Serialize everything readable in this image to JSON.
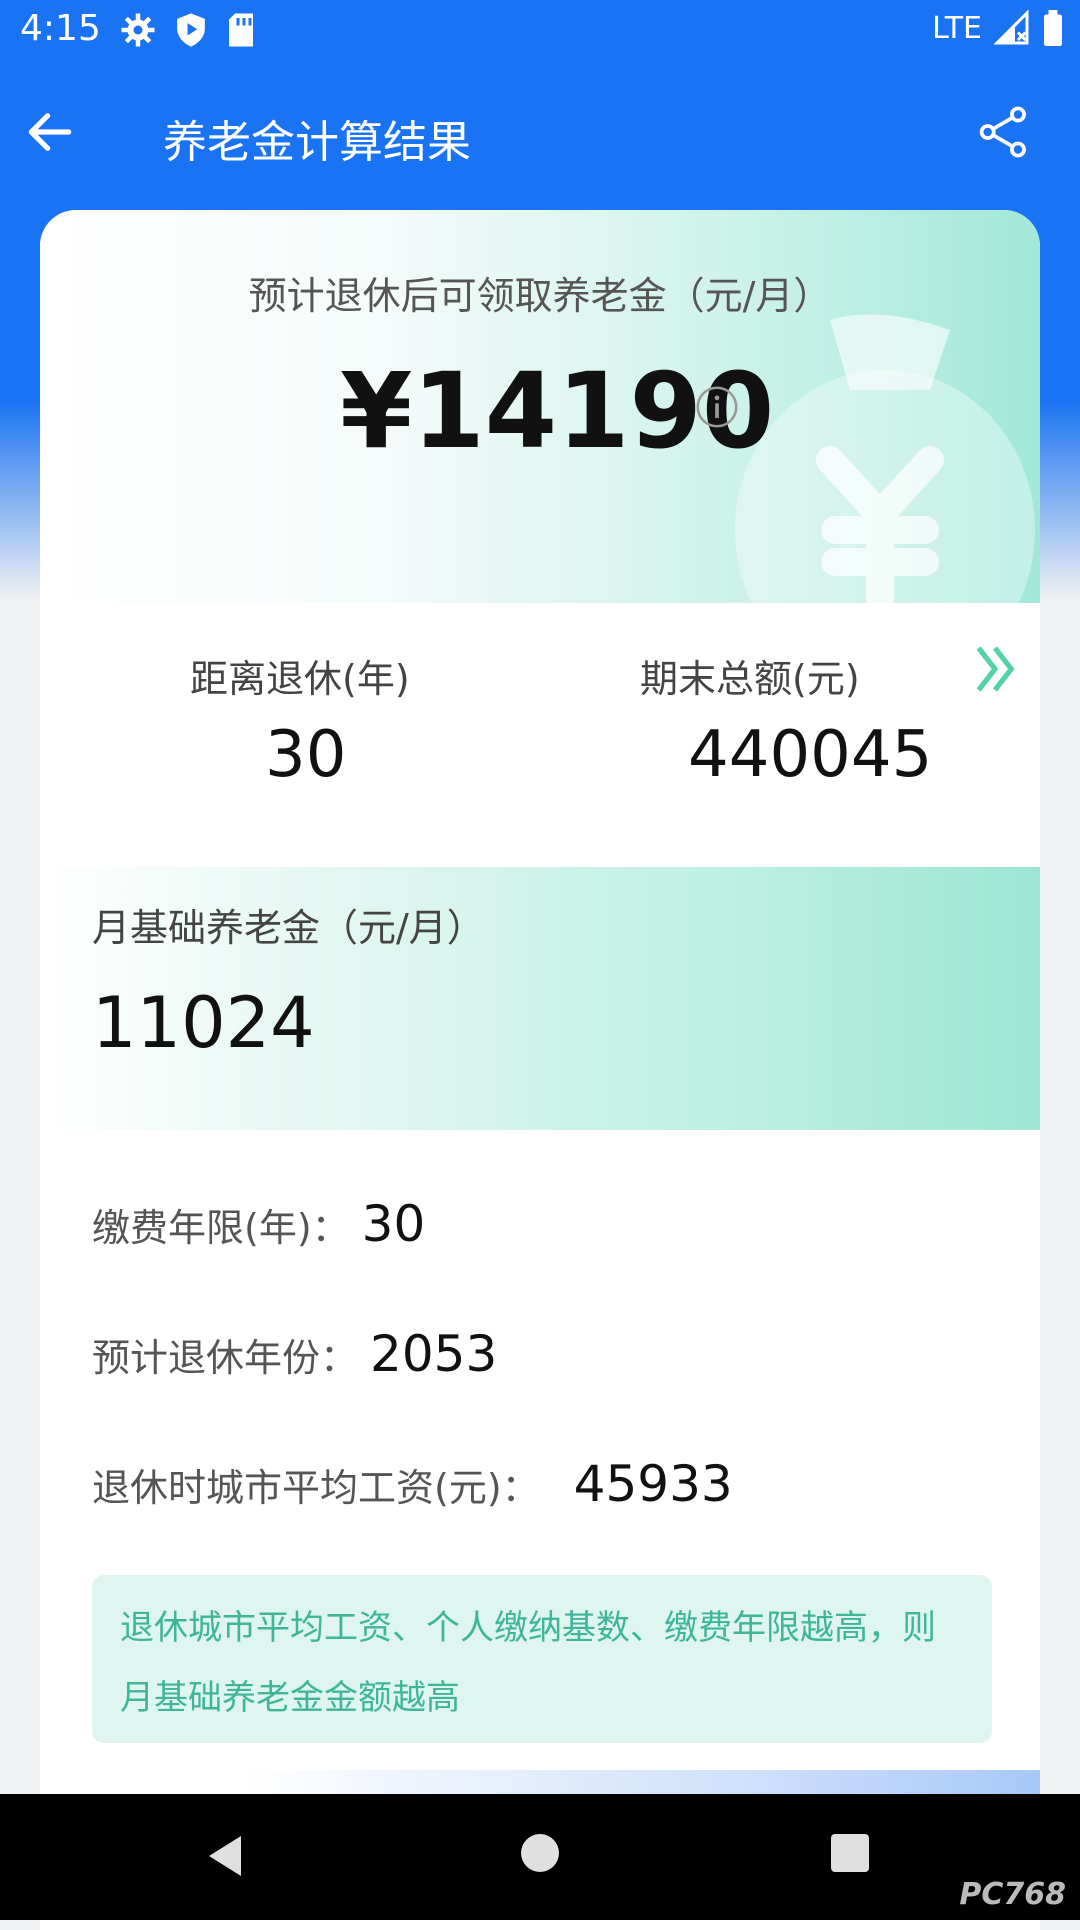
{
  "status_bar": {
    "time": "4:15",
    "network": "LTE",
    "icons": [
      "gear-icon",
      "shield-play-icon",
      "sd-card-icon",
      "signal-icon",
      "battery-icon"
    ]
  },
  "app_bar": {
    "title": "养老金计算结果",
    "back_icon": "arrow-left-icon",
    "share_icon": "share-icon"
  },
  "hero": {
    "label": "预计退休后可领取养老金（元/月）",
    "amount": "¥14190",
    "info_icon": "info-icon"
  },
  "stats": {
    "years_label": "距离退休(年)",
    "years_value": "30",
    "total_label": "期末总额(元)",
    "total_value": "440045",
    "more_icon": "double-chevron-right-icon"
  },
  "monthly": {
    "label": "月基础养老金（元/月）",
    "value": "11024"
  },
  "details": [
    {
      "label": "缴费年限(年)：",
      "value": "30"
    },
    {
      "label": "预计退休年份：",
      "value": "2053"
    },
    {
      "label": "退休时城市平均工资(元)：",
      "value": "45933"
    }
  ],
  "tip": {
    "line1": "退休城市平均工资、个人缴纳基数、缴费年限越高，则",
    "line2": "月基础养老金金额越高"
  },
  "watermark": "PC768",
  "colors": {
    "primary_blue": "#1a73f2",
    "accent_green": "#3fb59a",
    "teal_light": "#a2e8d9"
  }
}
